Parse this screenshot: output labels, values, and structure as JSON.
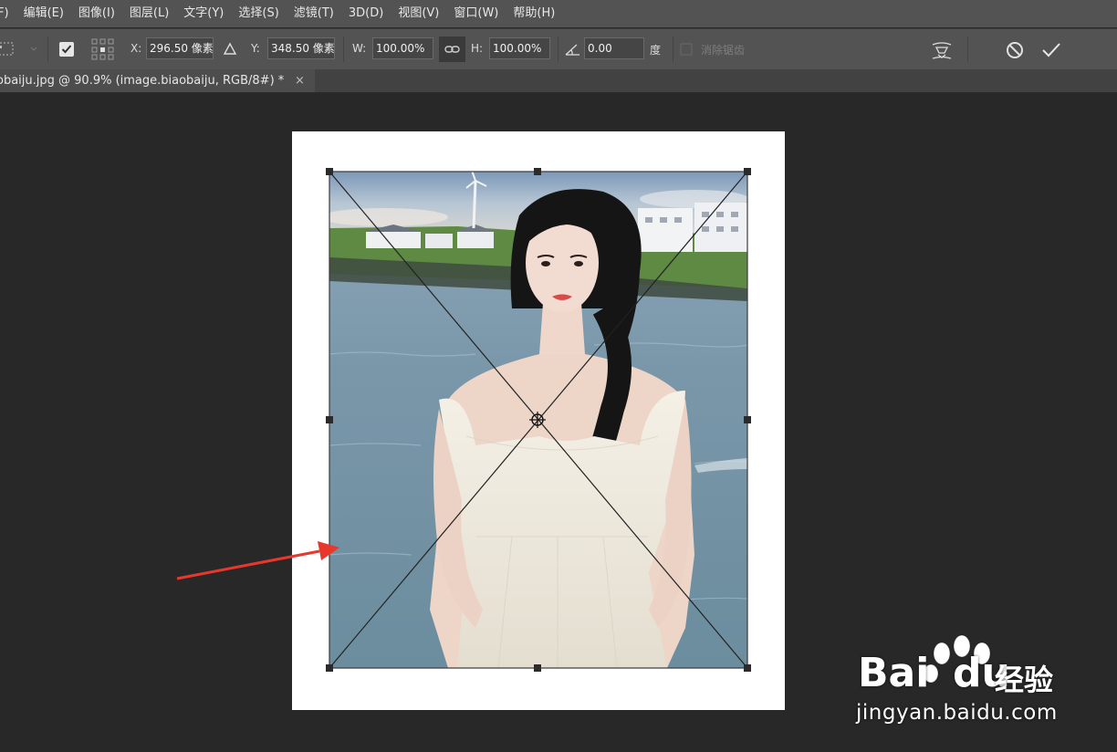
{
  "menu": {
    "items": [
      "F)",
      "编辑(E)",
      "图像(I)",
      "图层(L)",
      "文字(Y)",
      "选择(S)",
      "滤镜(T)",
      "3D(D)",
      "视图(V)",
      "窗口(W)",
      "帮助(H)"
    ]
  },
  "options": {
    "x_label": "X:",
    "x_value": "296.50 像素",
    "y_label": "Y:",
    "y_value": "348.50 像素",
    "w_label": "W:",
    "w_value": "100.00%",
    "h_label": "H:",
    "h_value": "100.00%",
    "angle_value": "0.00",
    "angle_unit": "度",
    "antialias_label": "消除锯齿"
  },
  "tab": {
    "title": "obaiju.jpg @ 90.9% (image.biaobaiju, RGB/8#) *",
    "close": "×"
  },
  "watermark": {
    "bai": "Bai",
    "du": "du",
    "jingyan": "经验",
    "url": "jingyan.baidu.com"
  },
  "colors": {
    "arrow": "#e8372c",
    "paw": "#ffffff"
  }
}
